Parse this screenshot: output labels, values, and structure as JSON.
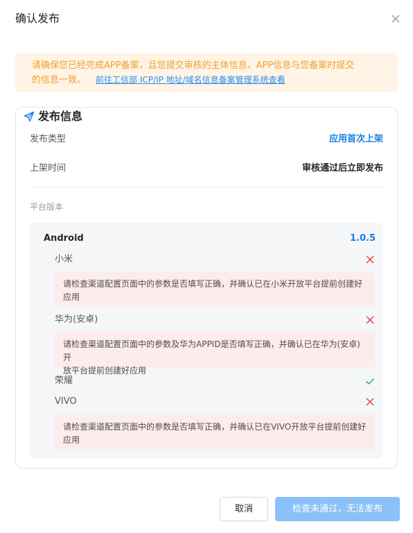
{
  "dialog": {
    "title": "确认发布",
    "close_icon": "close-icon"
  },
  "notice": {
    "line1": "请确保您已经完成APP备案，且您提交审核的主体信息、APP信息与您备案时提交",
    "line2": "的信息一致。",
    "link": "前往工信部 ICP/IP 地址/域名信息备案管理系统查看",
    "colors": {
      "background": "#fff4e6",
      "text": "#f0a030",
      "link": "#2a8ef0"
    }
  },
  "card": {
    "title": "发布信息",
    "title_icon": "send-icon",
    "publish_type": {
      "label": "发布类型",
      "value": "应用首次上架"
    },
    "release_time": {
      "label": "上架时间",
      "value": "审核通过后立即发布"
    },
    "platform_section_label": "平台版本",
    "platform": {
      "name": "Android",
      "version": "1.0.5",
      "stores": [
        {
          "name": "小米",
          "status": "error",
          "icon": "x-icon",
          "message_line1": "请检查渠道配置页面中的参数是否填写正确，并确认已在小米开放平台提前创建好",
          "message_line2": "应用"
        },
        {
          "name": "华为(安卓)",
          "status": "error",
          "icon": "x-icon",
          "message_line1": "请检查渠道配置页面中的参数及华为APPID是否填写正确，并确认已在华为(安卓)开",
          "message_line2": "放平台提前创建好应用"
        },
        {
          "name": "荣耀",
          "status": "ok",
          "icon": "check-icon"
        },
        {
          "name": "VIVO",
          "status": "error",
          "icon": "x-icon",
          "message_line1": "请检查渠道配置页面中的参数是否填写正确，并确认已在VIVO开放平台提前创建好",
          "message_line2": "应用"
        }
      ]
    }
  },
  "footer": {
    "cancel_label": "取消",
    "publish_label": "检查未通过，无法发布"
  },
  "colors": {
    "accent": "#1a7fe6",
    "error": "#e64545",
    "success": "#37b24d",
    "error_bg": "#fdecec",
    "disabled_button": "#8cc0f8"
  }
}
